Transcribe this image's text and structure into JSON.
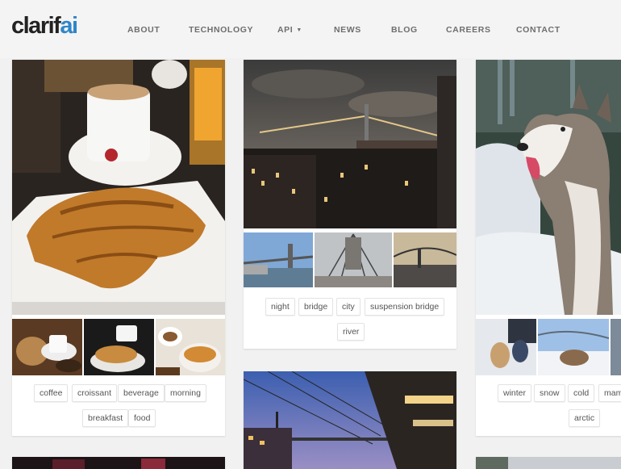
{
  "brand": {
    "part1": "clarif",
    "part2": "ai",
    "accent": "#2f86c8"
  },
  "nav": {
    "about": "ABOUT",
    "technology": "TECHNOLOGY",
    "api": "API",
    "news": "NEWS",
    "blog": "BLOG",
    "careers": "CAREERS",
    "contact": "CONTACT"
  },
  "cards": {
    "breakfast": {
      "image": "croissant-coffee-photo",
      "tags": [
        "coffee",
        "croissant",
        "beverage",
        "morning",
        "breakfast",
        "food"
      ]
    },
    "bridge": {
      "image": "night-bridge-city-photo",
      "tags": [
        "night",
        "bridge",
        "city",
        "suspension bridge",
        "river"
      ]
    },
    "dog": {
      "image": "husky-in-snow-photo",
      "tags": [
        "winter",
        "snow",
        "cold",
        "mam",
        "arctic"
      ]
    },
    "train": {
      "image": "train-station-dusk-photo"
    }
  }
}
